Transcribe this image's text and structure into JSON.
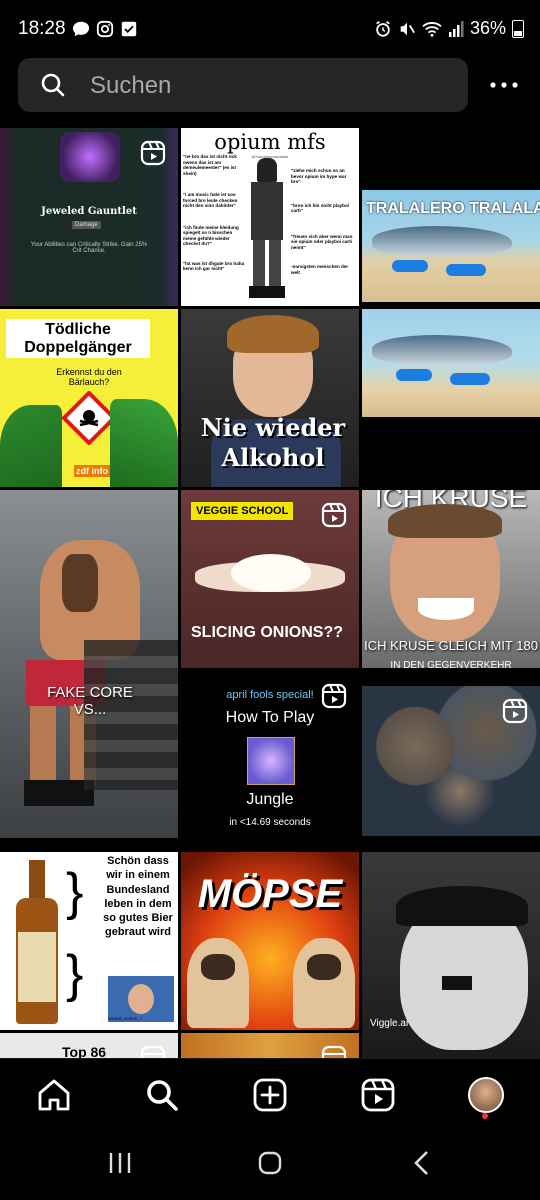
{
  "status_bar": {
    "time": "18:28",
    "battery": "36%"
  },
  "search": {
    "placeholder": "Suchen"
  },
  "grid": {
    "cells": [
      {
        "id": "jeweled",
        "title": "Jeweled Gauntlet",
        "sub": "Damage",
        "desc": "Your Abilities can Critically Strike. Gain 25% Crit Chance."
      },
      {
        "id": "opium",
        "title": "opium mfs",
        "handle": "@morgpfsucasnbsar",
        "quotes_left": [
          "\"ne bro das ist nicht rick owens das ist am demeulemeester\" (es ist shein)",
          "\"i am music hate ist soo forced bro leute checken nicht den sinn dahinter\"",
          "\"ich finde meine kleidung spiegelt so n bisschen meine gefühle wieder checkst du?\"",
          "\"hä was ist dhgate bro haha kenn ich gar nicht\""
        ],
        "quotes_right": [
          "\"ziehe mich schon so an bevor opium im hype war bro\"",
          "\"broo ich bin nicht playboi carti\"",
          "\"freuen sich aber wenn man sie opium oder playboi carti nennt\"",
          "-narvigsten menschen der welt"
        ]
      },
      {
        "id": "tralalero",
        "text": "TRALALERO TRALALA"
      },
      {
        "id": "doppel",
        "title": "Tödliche Doppelgänger",
        "sub": "Erkennst du den Bärlauch?",
        "logo": "zdf info"
      },
      {
        "id": "alkohol",
        "text": "Nie wieder Alkohol"
      },
      {
        "id": "shark2"
      },
      {
        "id": "fakecore",
        "text": "FAKE CORE VS..."
      },
      {
        "id": "onions",
        "tag": "VEGGIE SCHOOL",
        "text": "SLICING ONIONS??"
      },
      {
        "id": "kruse",
        "top": "ICH KRUSE",
        "bottom": "ICH KRUSE GLEICH MIT 180",
        "bottom2": "IN DEN GEGENVERKEHR"
      },
      {
        "id": "howto",
        "special": "april fools special!",
        "line1": "How To Play",
        "line2": "Jungle",
        "line3": "in <14.69 seconds"
      },
      {
        "id": "map"
      },
      {
        "id": "bier",
        "text": "Schön dass wir in einem Bundesland leben in dem so gutes Bier gebraut wird",
        "caption": "SAUER_KURVE_7"
      },
      {
        "id": "moepse",
        "text": "MÖPSE"
      },
      {
        "id": "viggle",
        "watermark": "Viggle.ai"
      },
      {
        "id": "bottom1",
        "text": "Top 86"
      }
    ]
  },
  "colors": {
    "search_bg": "#262626",
    "placeholder": "#a8a8a8",
    "veggie": "#f2e600",
    "notify": "#ff3040"
  }
}
